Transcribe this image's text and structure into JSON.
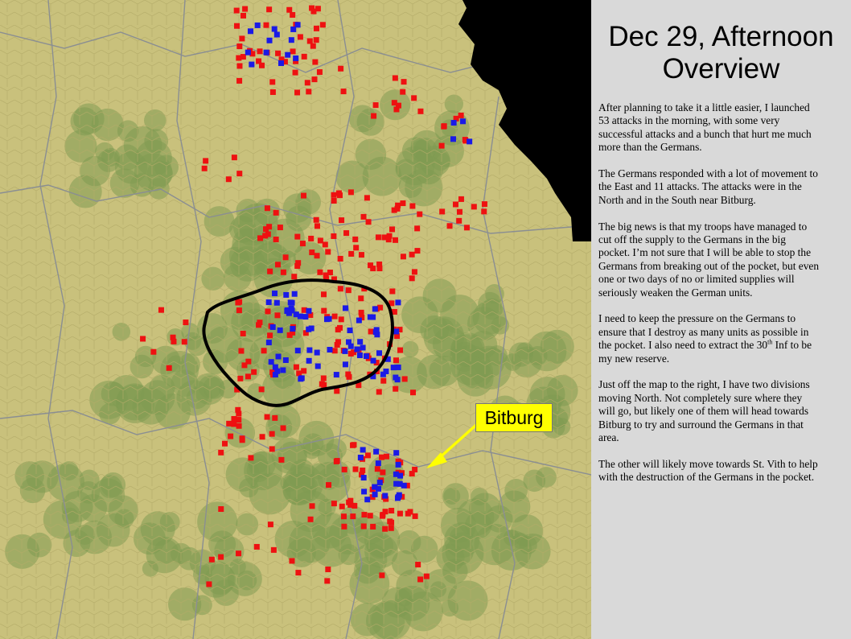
{
  "slide": {
    "title_line1": "Dec 29, Afternoon",
    "title_line2": "Overview",
    "paragraphs": [
      "After planning to take it a little easier, I launched 53 attacks in the morning, with some very successful attacks and a bunch that hurt me much more than the Germans.",
      "The Germans responded with a lot of movement to the East and 11 attacks.  The attacks were in the North and in the South near Bitburg.",
      "The big news is that my troops have managed to cut off the supply to the Germans in the big pocket.  I’m not sure that I will be able to stop the Germans from breaking out of the pocket, but even one or two days of no or limited supplies will seriously weaken the German units."
    ],
    "para4_before": "I need to keep the pressure on the Germans to ensure that I destroy as many units as possible in the pocket.  I also need to extract the 30",
    "para4_sup": "th",
    "para4_after": " Inf to be my new reserve.",
    "paragraphs_tail": [
      "Just off the map to the right, I have two divisions moving North.  Not completely sure where they will go, but likely one of them will head towards Bitburg to try and surround the Germans in that area.",
      "The other will likely move towards St. Vith to help with the destruction of the Germans in the pocket."
    ]
  },
  "map": {
    "callout_label": "Bitburg",
    "colors": {
      "terrain": "#c8c07a",
      "forest": "#7f9a52",
      "allied_unit": "#ee1111",
      "german_unit": "#1a1ae6",
      "offmap": "#000000",
      "pocket_outline": "#000000",
      "callout": "#ffff00"
    },
    "icons": [
      "allied-unit-icon",
      "german-unit-icon",
      "pocket-outline",
      "callout-arrow-icon"
    ]
  }
}
